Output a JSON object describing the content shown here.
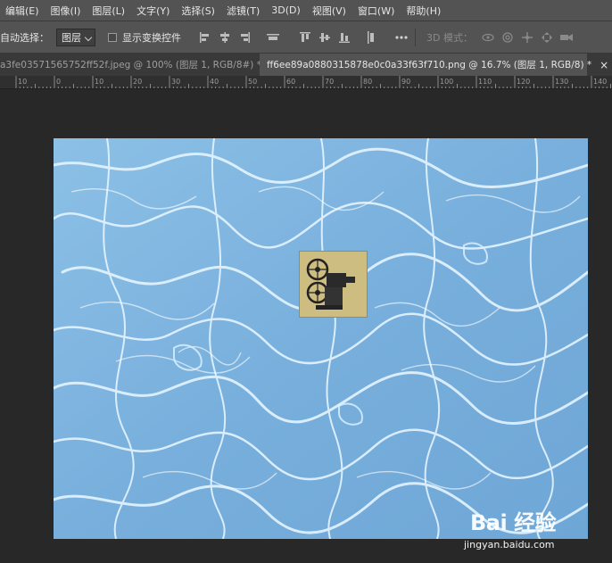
{
  "menu": {
    "items": [
      "编辑(E)",
      "图像(I)",
      "图层(L)",
      "文字(Y)",
      "选择(S)",
      "滤镜(T)",
      "3D(D)",
      "视图(V)",
      "窗口(W)",
      "帮助(H)"
    ]
  },
  "options": {
    "auto_select_label": "自动选择：",
    "auto_select_value": "图层",
    "show_transform_label": "显示变换控件",
    "mode_3d_label": "3D 模式："
  },
  "tabs": [
    {
      "label": "a3fe03571565752ff52f.jpeg @ 100% (图层 1, RGB/8#) *",
      "close": "×",
      "active": false
    },
    {
      "label": "ff6ee89a0880315878e0c0a33f63f710.png @ 16.7% (图层 1, RGB/8) *",
      "close": "×",
      "active": true
    }
  ],
  "ruler": {
    "labels": [
      "10",
      "0",
      "10",
      "20",
      "30",
      "40",
      "50",
      "60",
      "70",
      "80",
      "90",
      "100",
      "110",
      "120",
      "130",
      "140"
    ]
  },
  "watermark": {
    "logo": "Bai 经验",
    "url": "jingyan.baidu.com"
  },
  "colors": {
    "menubar": "#535353",
    "workspace": "#282828",
    "water": "#7fb4df"
  }
}
